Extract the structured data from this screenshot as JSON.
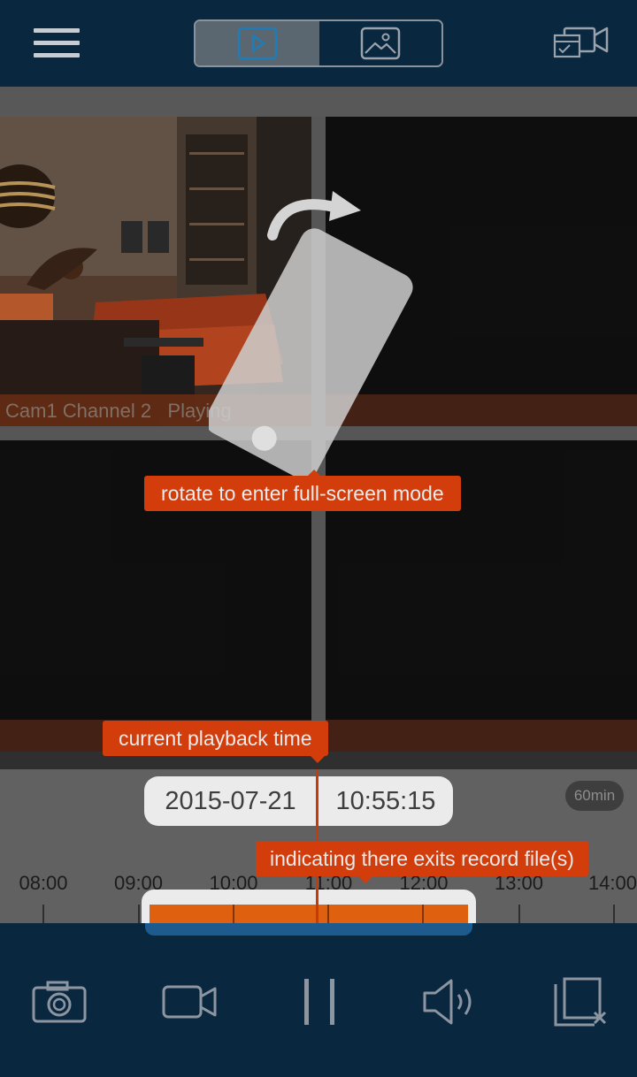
{
  "header": {
    "icons": {
      "menu": "hamburger-menu-icon",
      "playback_mode": "play-icon",
      "snapshot_mode": "image-icon",
      "device_list": "camera-list-icon"
    }
  },
  "grid": {
    "tiles": [
      {
        "label": "Cam1 Channel 2   Playing"
      },
      {
        "label": ""
      },
      {
        "label": ""
      },
      {
        "label": ""
      }
    ]
  },
  "tips": {
    "rotate": "rotate to enter full-screen mode",
    "current": "current playback time",
    "record": "indicating there exits record file(s)"
  },
  "timeline": {
    "date": "2015-07-21",
    "time": "10:55:15",
    "zoom": "60min",
    "ticks": [
      "08:00",
      "09:00",
      "10:00",
      "11:00",
      "12:00",
      "13:00",
      "14:00"
    ],
    "record_color": "#f26a12",
    "playhead_color": "#d8400c"
  },
  "controls": {
    "icons": [
      "camera-snapshot-icon",
      "video-record-icon",
      "pause-icon",
      "volume-icon",
      "close-window-icon"
    ]
  },
  "colors": {
    "navy": "#0a2740",
    "accent": "#e4430c"
  }
}
